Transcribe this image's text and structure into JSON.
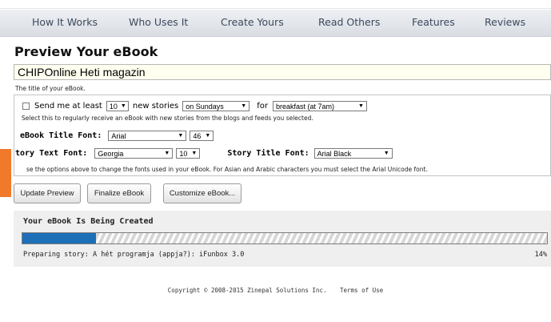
{
  "nav": {
    "items": [
      "How It Works",
      "Who Uses It",
      "Create Yours",
      "Read Others",
      "Features",
      "Reviews"
    ]
  },
  "page": {
    "title": "Preview Your eBook",
    "ebook_title_value": "CHIPOnline Heti magazin",
    "ebook_title_hint": "The title of your eBook."
  },
  "options": {
    "send_me_label": "Send me at least",
    "send_count": "10",
    "new_stories_label": "new stories",
    "day": "on Sundays",
    "for_label": "for",
    "time": "breakfast (at 7am)",
    "send_hint": "Select this to regularly receive an eBook with new stories from the blogs and feeds you selected.",
    "title_font_label": "eBook Title Font:",
    "title_font": "Arial",
    "title_font_size": "46",
    "story_text_font_label": "tory Text Font:",
    "story_text_font": "Georgia",
    "story_text_font_size": "10",
    "story_title_font_label": "Story Title Font:",
    "story_title_font": "Arial Black",
    "fonts_hint": "se the options above to change the fonts used in your eBook. For Asian and Arabic characters you must select the Arial Unicode font."
  },
  "buttons": {
    "update": "Update Preview",
    "finalize": "Finalize eBook",
    "customize": "Customize eBook..."
  },
  "progress": {
    "title": "Your eBook Is Being Created",
    "status": "Preparing story: A hét programja (appja?): iFunbox 3.0",
    "percent_label": "14%",
    "fraction": 0.14,
    "fill_color": "#1d6fb7"
  },
  "footer": {
    "copyright": "Copyright © 2008-2015 Zinepal Solutions Inc.",
    "terms": "Terms of Use"
  }
}
